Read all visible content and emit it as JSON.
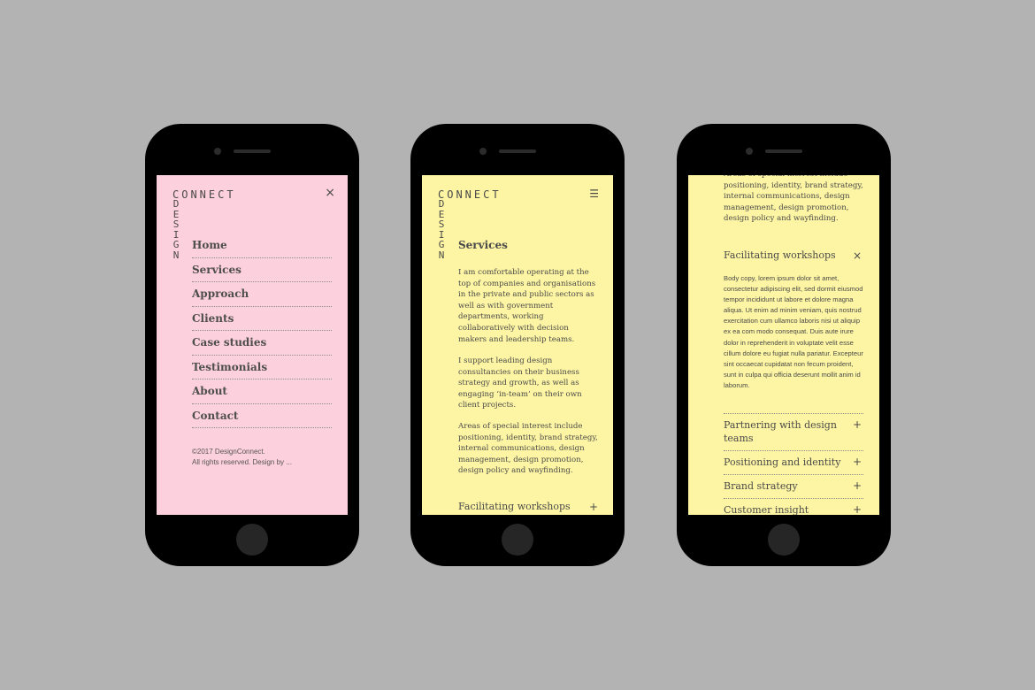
{
  "brand": {
    "word_top": "CONNECT",
    "word_side": [
      "D",
      "E",
      "S",
      "I",
      "G",
      "N"
    ]
  },
  "phone1": {
    "close_icon": "×",
    "menu": [
      "Home",
      "Services",
      "Approach",
      "Clients",
      "Case studies",
      "Testimonials",
      "About",
      "Contact"
    ],
    "footer_line1": "©2017 DesignConnect.",
    "footer_line2": "All rights reserved. Design by ..."
  },
  "phone2": {
    "menu_icon": "☰",
    "heading": "Services",
    "paragraphs": [
      "I am comfortable operating at the top of companies and organisations in the private and public sectors as well as with government departments, working collaboratively with decision makers and leadership teams.",
      "I support leading design consultancies on their business strategy and growth, as well as engaging ‘in-team’ on their own client projects.",
      "Areas of special interest include positioning, identity, brand strategy, internal communications, design management, design promotion, design policy and wayfinding."
    ],
    "accordion_label": "Facilitating workshops",
    "accordion_icon": "+"
  },
  "phone3": {
    "top_text": "Areas of special interest include positioning, identity, brand strategy, internal communications, design management, design promotion, design policy and wayfinding.",
    "open_item": {
      "label": "Facilitating workshops",
      "icon": "×",
      "body": "Body copy, lorem ipsum dolor sit amet, consectetur adipiscing elit, sed dormit eiusmod tempor incididunt ut labore et dolore magna aliqua. Ut enim ad minim veniam, quis nostrud exercitation cum ullamco laboris nisi ut aliquip ex ea com modo consequat. Duis aute irure dolor in reprehenderit in voluptate velit esse cillum dolore eu fugiat nulla pariatur. Excepteur sint occaecat cupidatat non fecum proident, sunt in culpa qui officia deserunt mollit anim id laborum."
    },
    "items": [
      {
        "label": "Partnering with design teams",
        "icon": "+"
      },
      {
        "label": "Positioning and identity",
        "icon": "+"
      },
      {
        "label": "Brand strategy",
        "icon": "+"
      },
      {
        "label": "Customer insight",
        "icon": "+"
      }
    ]
  },
  "colors": {
    "background": "#b3b3b3",
    "phone": "#000000",
    "screen_pink": "#fcd0dc",
    "screen_yellow": "#fdf5a3",
    "text": "#4a4a4a"
  }
}
